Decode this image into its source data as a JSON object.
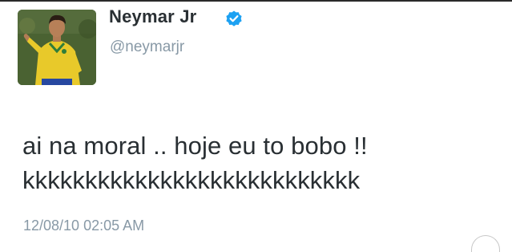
{
  "tweet": {
    "user_name": "Neymar Jr",
    "handle": "@neymarjr",
    "text_lines": [
      "ai na moral .. hoje eu to bobo !!",
      "kkkkkkkkkkkkkkkkkkkkkkkkkkk"
    ],
    "timestamp": "12/08/10 02:05 AM"
  },
  "colors": {
    "name": "#292f33",
    "handle": "#8899a6",
    "text": "#292f33",
    "timestamp": "#8899a6",
    "verified": "#1da1f2"
  },
  "icons": {
    "verified": "verified-badge-icon",
    "avatar": "profile-photo"
  }
}
